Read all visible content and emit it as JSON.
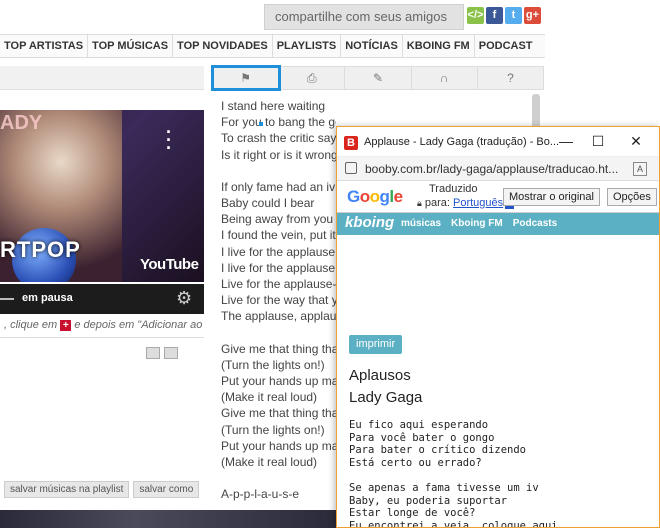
{
  "share": {
    "label": "compartilhe com seus amigos",
    "icons": [
      {
        "name": "embed-icon",
        "glyph": "</>",
        "color": "#8bc34a"
      },
      {
        "name": "facebook-icon",
        "glyph": "f",
        "color": "#3b5998"
      },
      {
        "name": "twitter-icon",
        "glyph": "t",
        "color": "#55acee"
      },
      {
        "name": "googleplus-icon",
        "glyph": "g+",
        "color": "#dd4b39"
      }
    ]
  },
  "nav": {
    "items": [
      "TOP ARTISTAS",
      "TOP MÚSICAS",
      "TOP NOVIDADES",
      "PLAYLISTS",
      "NOTÍCIAS",
      "KBOING FM",
      "PODCAST"
    ]
  },
  "toolbar": {
    "icons": [
      {
        "name": "translate-flag-icon",
        "glyph": "⚑"
      },
      {
        "name": "print-icon",
        "glyph": "⎙"
      },
      {
        "name": "edit-icon",
        "glyph": "✎"
      },
      {
        "name": "headphones-icon",
        "glyph": "∩"
      },
      {
        "name": "help-icon",
        "glyph": "?"
      }
    ]
  },
  "video": {
    "lady_text": "ADY",
    "album_text": "RTPOP",
    "brand": "YouTube",
    "status": "em pausa"
  },
  "hint": {
    "before": ", clique em",
    "plus": "+",
    "after": "e depois em \"Adicionar ao"
  },
  "playlist_buttons": [
    "salvar músicas na playlist",
    "salvar como"
  ],
  "lyrics": {
    "lines": [
      "I stand here waiting",
      "For you to bang the gong",
      "To crash the critic say",
      "Is it right or is it wrong",
      "",
      "If only fame had an iv",
      "Baby could I bear",
      "Being away from you",
      "I found the vein, put it",
      "I live for the applause",
      "I live for the applause",
      "Live for the applause-",
      "Live for the way that y",
      "The applause, applau",
      "",
      "Give me that thing tha",
      "(Turn the lights on!)",
      "Put your hands up ma",
      "(Make it real loud)",
      "Give me that thing tha",
      "(Turn the lights on!)",
      "Put your hands up ma",
      "(Make it real loud)",
      "",
      "A-p-p-l-a-u-s-e"
    ]
  },
  "popup": {
    "title": "Applause - Lady Gaga (tradução) - Bo...",
    "controls": {
      "minimize": "—",
      "maximize": "☐",
      "close": "✕"
    },
    "url": "booby.com.br/lady-gaga/applause/traducao.ht...",
    "translate": {
      "google": "Google",
      "line1": "Traduzido",
      "line2_prefix": "para:",
      "language": "Português",
      "show_original": "Mostrar o original",
      "options": "Opções"
    },
    "kboing": {
      "logo": "kboing",
      "items": [
        "músicas",
        "Kboing FM",
        "Podcasts"
      ]
    },
    "print_label": "imprimir",
    "song_title": "Aplausos",
    "artist": "Lady Gaga",
    "lyrics": [
      "Eu fico aqui esperando",
      "Para você bater o gongo",
      "Para bater o crítico dizendo",
      "Está certo ou errado?",
      "",
      "Se apenas a fama tivesse um iv",
      "Baby, eu poderia suportar",
      "Estar longe de você?",
      "Eu encontrei a veia, coloque aqui"
    ]
  }
}
